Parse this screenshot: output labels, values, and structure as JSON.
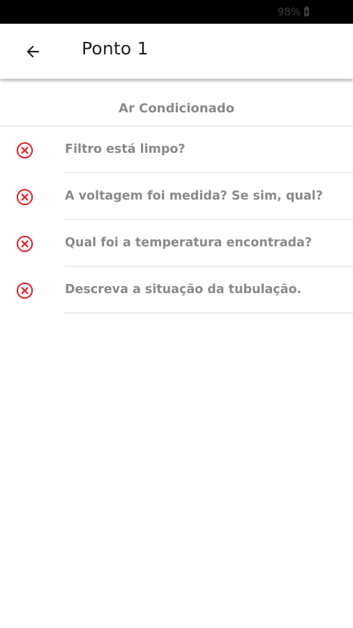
{
  "status_bar": {
    "battery_text": "98%"
  },
  "header": {
    "title": "Ponto 1",
    "back_icon": "arrow-left-icon"
  },
  "section": {
    "title": "Ar Condicionado"
  },
  "checklist": {
    "status_color": "#e0232b",
    "items": [
      {
        "label": "Filtro está limpo?",
        "status_icon": "close-circle-icon"
      },
      {
        "label": "A voltagem foi medida? Se sim, qual?",
        "status_icon": "close-circle-icon"
      },
      {
        "label": "Qual foi a temperatura encontrada?",
        "status_icon": "close-circle-icon"
      },
      {
        "label": "Descreva a situação da tubulação.",
        "status_icon": "close-circle-icon"
      }
    ]
  }
}
